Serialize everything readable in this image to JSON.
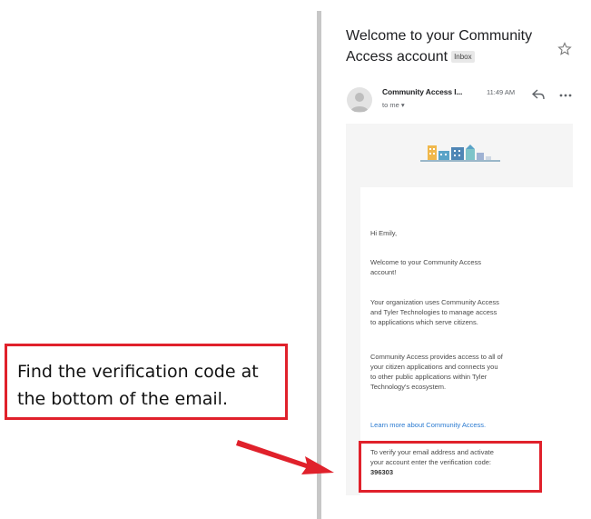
{
  "callout": {
    "line1": "Find the verification code at",
    "line2": "the bottom of the email."
  },
  "email": {
    "subject_line1": "Welcome to your Community",
    "subject_line2": "Access account",
    "badge": "Inbox",
    "sender": "Community Access I...",
    "time": "11:49 AM",
    "recipient": "to me",
    "greeting": "Hi Emily,",
    "welcome_line1": "Welcome to your Community Access",
    "welcome_line2": "account!",
    "org_line1": "Your organization uses Community Access",
    "org_line2": "and Tyler Technologies to manage access",
    "org_line3": "to applications which serve citizens.",
    "provides_line1": "Community Access provides access to all of",
    "provides_line2": "your citizen applications and connects you",
    "provides_line3": "to other public applications within Tyler",
    "provides_line4": "Technology's ecosystem.",
    "learn_more": "Learn more about Community Access.",
    "verify_line1": "To verify your email address and activate",
    "verify_line2": "your account enter the verification code:",
    "verification_code": "396303"
  },
  "icons": {
    "star": "star-icon",
    "reply": "reply-icon",
    "more": "more-options-icon",
    "avatar": "avatar",
    "logo": "community-buildings-logo"
  },
  "colors": {
    "highlight": "#e0212b",
    "link": "#2a7ad1",
    "divider": "#c7c7c7"
  }
}
